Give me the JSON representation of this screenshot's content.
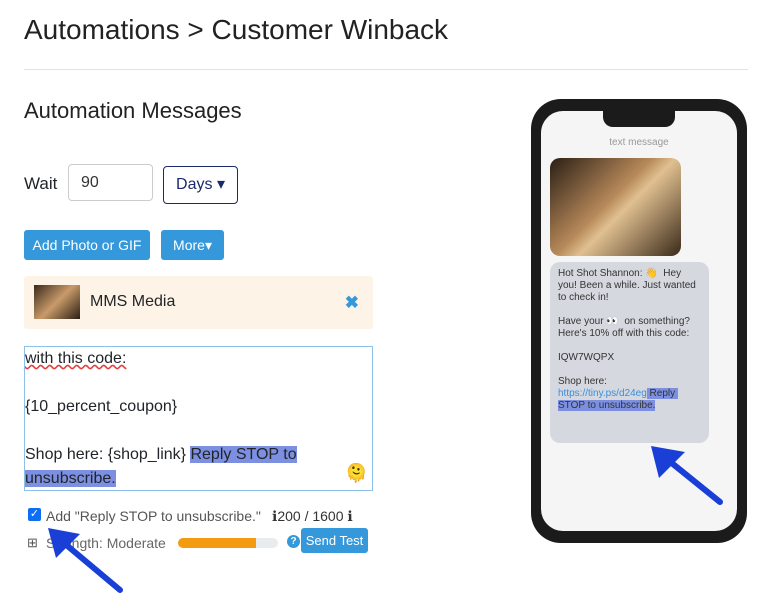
{
  "breadcrumb": "Automations > Customer Winback",
  "section_title": "Automation Messages",
  "wait": {
    "label": "Wait",
    "value": "90",
    "unit": "Days"
  },
  "buttons": {
    "add_photo": "Add Photo or GIF",
    "more": "More",
    "send_test": "Send Test"
  },
  "media": {
    "label": "MMS Media"
  },
  "editor": {
    "line1": "with this code:",
    "line2": "{10_percent_coupon}",
    "line3_prefix": "Shop here: {shop_link}",
    "line3_hl": "Reply STOP to",
    "line4_hl": "unsubscribe."
  },
  "options": {
    "add_stop_label": "Add \"Reply STOP to unsubscribe.\"",
    "add_stop_checked": true,
    "char_count": "200 / 1600",
    "strength_label": "Strength: Moderate",
    "strength_percent": 78
  },
  "preview": {
    "header": "text message",
    "msg1": "Hot Shot Shannon: 👋  Hey you! Been a while. Just wanted to check in!\n\nHave your 👀  on something? Here's 10% off with this code:\n\nIQW7WQPX\n\nShop here:\n",
    "link": "https://tiny.ps/d24eg",
    "hl": " Reply STOP to unsubscribe."
  },
  "colors": {
    "accent": "#3498db",
    "highlight": "#7c8fe0",
    "strength": "#f39c12",
    "annotation_arrow": "#1a3fd6"
  }
}
